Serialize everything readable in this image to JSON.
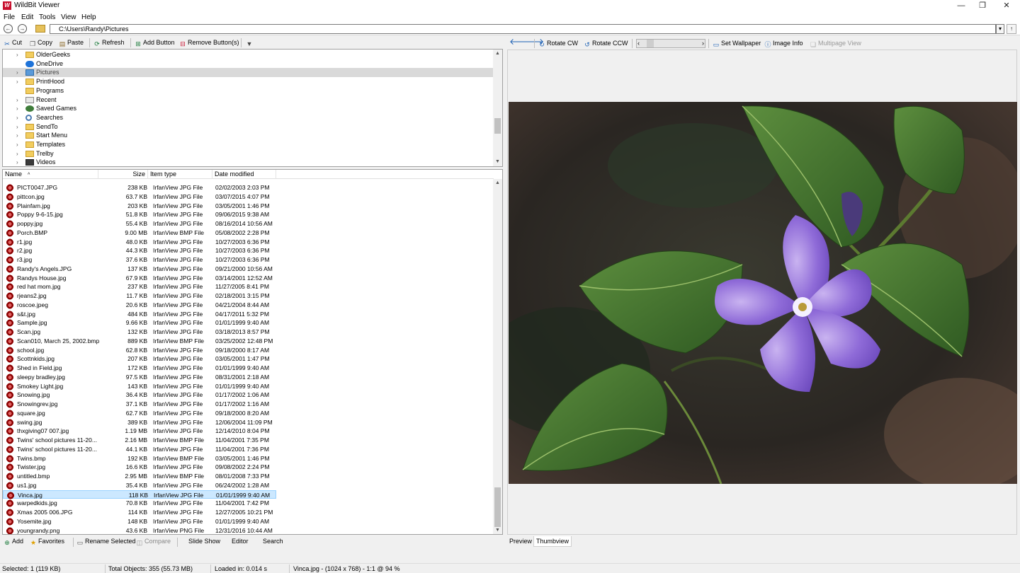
{
  "window": {
    "title": "WildBit Viewer",
    "icon_text": "W",
    "minimize": "—",
    "maximize": "❐",
    "close": "✕"
  },
  "menu": [
    "File",
    "Edit",
    "Tools",
    "View",
    "Help"
  ],
  "address": {
    "path": "C:\\Users\\Randy\\Pictures"
  },
  "left_toolbar": {
    "cut": "Cut",
    "copy": "Copy",
    "paste": "Paste",
    "refresh": "Refresh",
    "add_button": "Add Button",
    "remove_button": "Remove Button(s)"
  },
  "tree": [
    {
      "label": "OlderGeeks",
      "icon": "folder",
      "expand": "›"
    },
    {
      "label": "OneDrive",
      "icon": "cloud",
      "expand": ""
    },
    {
      "label": "Pictures",
      "icon": "pictures",
      "expand": "›",
      "selected": true
    },
    {
      "label": "PrintHood",
      "icon": "folder",
      "expand": "›"
    },
    {
      "label": "Programs",
      "icon": "folder",
      "expand": ""
    },
    {
      "label": "Recent",
      "icon": "recent",
      "expand": "›"
    },
    {
      "label": "Saved Games",
      "icon": "games",
      "expand": "›"
    },
    {
      "label": "Searches",
      "icon": "search",
      "expand": "›"
    },
    {
      "label": "SendTo",
      "icon": "folder",
      "expand": "›"
    },
    {
      "label": "Start Menu",
      "icon": "folder",
      "expand": "›"
    },
    {
      "label": "Templates",
      "icon": "folder",
      "expand": "›"
    },
    {
      "label": "Trelby",
      "icon": "folder",
      "expand": "›"
    },
    {
      "label": "Videos",
      "icon": "videos",
      "expand": "›"
    }
  ],
  "file_headers": {
    "name": "Name",
    "size": "Size",
    "type": "Item type",
    "date": "Date modified"
  },
  "files": [
    {
      "name": "PICT0047.JPG",
      "size": "238 KB",
      "type": "IrfanView JPG File",
      "date": "02/02/2003 2:03 PM"
    },
    {
      "name": "pittcon.jpg",
      "size": "63.7 KB",
      "type": "IrfanView JPG File",
      "date": "03/07/2015 4:07 PM"
    },
    {
      "name": "Plainfam.jpg",
      "size": "203 KB",
      "type": "IrfanView JPG File",
      "date": "03/05/2001 1:46 PM"
    },
    {
      "name": "Poppy 9-6-15.jpg",
      "size": "51.8 KB",
      "type": "IrfanView JPG File",
      "date": "09/06/2015 9:38 AM"
    },
    {
      "name": "poppy.jpg",
      "size": "55.4 KB",
      "type": "IrfanView JPG File",
      "date": "08/16/2014 10:56 AM"
    },
    {
      "name": "Porch.BMP",
      "size": "9.00 MB",
      "type": "IrfanView BMP File",
      "date": "05/08/2002 2:28 PM"
    },
    {
      "name": "r1.jpg",
      "size": "48.0 KB",
      "type": "IrfanView JPG File",
      "date": "10/27/2003 6:36 PM"
    },
    {
      "name": "r2.jpg",
      "size": "44.3 KB",
      "type": "IrfanView JPG File",
      "date": "10/27/2003 6:36 PM"
    },
    {
      "name": "r3.jpg",
      "size": "37.6 KB",
      "type": "IrfanView JPG File",
      "date": "10/27/2003 6:36 PM"
    },
    {
      "name": "Randy's Angels.JPG",
      "size": "137 KB",
      "type": "IrfanView JPG File",
      "date": "09/21/2000 10:56 AM"
    },
    {
      "name": "Randys House.jpg",
      "size": "67.9 KB",
      "type": "IrfanView JPG File",
      "date": "03/14/2001 12:52 AM"
    },
    {
      "name": "red hat mom.jpg",
      "size": "237 KB",
      "type": "IrfanView JPG File",
      "date": "11/27/2005 8:41 PM"
    },
    {
      "name": "rjeans2.jpg",
      "size": "11.7 KB",
      "type": "IrfanView JPG File",
      "date": "02/18/2001 3:15 PM"
    },
    {
      "name": "roscoe.jpeg",
      "size": "20.6 KB",
      "type": "IrfanView JPG File",
      "date": "04/21/2004 8:44 AM"
    },
    {
      "name": "s&t.jpg",
      "size": "484 KB",
      "type": "IrfanView JPG File",
      "date": "04/17/2011 5:32 PM"
    },
    {
      "name": "Sample.jpg",
      "size": "9.66 KB",
      "type": "IrfanView JPG File",
      "date": "01/01/1999 9:40 AM"
    },
    {
      "name": "Scan.jpg",
      "size": "132 KB",
      "type": "IrfanView JPG File",
      "date": "03/18/2013 8:57 PM"
    },
    {
      "name": "Scan010, March 25, 2002.bmp",
      "size": "889 KB",
      "type": "IrfanView BMP File",
      "date": "03/25/2002 12:48 PM"
    },
    {
      "name": "school.jpg",
      "size": "62.8 KB",
      "type": "IrfanView JPG File",
      "date": "09/18/2000 8:17 AM"
    },
    {
      "name": "Scottnkids.jpg",
      "size": "207 KB",
      "type": "IrfanView JPG File",
      "date": "03/05/2001 1:47 PM"
    },
    {
      "name": "Shed in Field.jpg",
      "size": "172 KB",
      "type": "IrfanView JPG File",
      "date": "01/01/1999 9:40 AM"
    },
    {
      "name": "sleepy bradley.jpg",
      "size": "97.5 KB",
      "type": "IrfanView JPG File",
      "date": "08/31/2001 2:18 AM"
    },
    {
      "name": "Smokey Light.jpg",
      "size": "143 KB",
      "type": "IrfanView JPG File",
      "date": "01/01/1999 9:40 AM"
    },
    {
      "name": "Snowing.jpg",
      "size": "36.4 KB",
      "type": "IrfanView JPG File",
      "date": "01/17/2002 1:06 AM"
    },
    {
      "name": "Snowingrev.jpg",
      "size": "37.1 KB",
      "type": "IrfanView JPG File",
      "date": "01/17/2002 1:16 AM"
    },
    {
      "name": "square.jpg",
      "size": "62.7 KB",
      "type": "IrfanView JPG File",
      "date": "09/18/2000 8:20 AM"
    },
    {
      "name": "swing.jpg",
      "size": "389 KB",
      "type": "IrfanView JPG File",
      "date": "12/06/2004 11:09 PM"
    },
    {
      "name": "thxgiving07 007.jpg",
      "size": "1.19 MB",
      "type": "IrfanView JPG File",
      "date": "12/14/2010 8:04 PM"
    },
    {
      "name": "Twins' school pictures 11-20...",
      "size": "2.16 MB",
      "type": "IrfanView BMP File",
      "date": "11/04/2001 7:35 PM"
    },
    {
      "name": "Twins' school pictures 11-20...",
      "size": "44.1 KB",
      "type": "IrfanView JPG File",
      "date": "11/04/2001 7:36 PM"
    },
    {
      "name": "Twins.bmp",
      "size": "192 KB",
      "type": "IrfanView BMP File",
      "date": "03/05/2001 1:46 PM"
    },
    {
      "name": "Twister.jpg",
      "size": "16.6 KB",
      "type": "IrfanView JPG File",
      "date": "09/08/2002 2:24 PM"
    },
    {
      "name": "untitled.bmp",
      "size": "2.95 MB",
      "type": "IrfanView BMP File",
      "date": "08/01/2008 7:33 PM"
    },
    {
      "name": "us1.jpg",
      "size": "35.4 KB",
      "type": "IrfanView JPG File",
      "date": "06/24/2002 1:28 AM"
    },
    {
      "name": "Vinca.jpg",
      "size": "118 KB",
      "type": "IrfanView JPG File",
      "date": "01/01/1999 9:40 AM",
      "selected": true
    },
    {
      "name": "warpedkids.jpg",
      "size": "70.8 KB",
      "type": "IrfanView JPG File",
      "date": "11/04/2001 7:42 PM"
    },
    {
      "name": "Xmas 2005 006.JPG",
      "size": "114 KB",
      "type": "IrfanView JPG File",
      "date": "12/27/2005 10:21 PM"
    },
    {
      "name": "Yosemite.jpg",
      "size": "148 KB",
      "type": "IrfanView JPG File",
      "date": "01/01/1999 9:40 AM"
    },
    {
      "name": "youngrandy.png",
      "size": "43.6 KB",
      "type": "IrfanView PNG File",
      "date": "12/31/2016 10:44 AM"
    }
  ],
  "left_bottom": {
    "add": "Add",
    "favorites": "Favorites",
    "rename": "Rename Selected",
    "compare": "Compare",
    "slideshow": "Slide Show",
    "editor": "Editor",
    "search": "Search"
  },
  "right_toolbar": {
    "rotate_cw": "Rotate CW",
    "rotate_ccw": "Rotate CCW",
    "set_wallpaper": "Set Wallpaper",
    "image_info": "Image Info",
    "multipage": "Multipage View"
  },
  "right_tabs": {
    "preview": "Preview",
    "thumbview": "Thumbview"
  },
  "status": {
    "selected": "Selected: 1 (119 KB)",
    "total": "Total Objects: 355 (55.73 MB)",
    "loaded": "Loaded in: 0.014 s",
    "image": "Vinca.jpg -  (1024 x 768) - 1:1 @ 94  %"
  },
  "colors": {
    "selection": "#cce8ff",
    "tree_selection": "#d9d9d9",
    "accent_icon": "#c8102e",
    "flower": "#8e6bd6",
    "leaf": "#3f6b2e"
  }
}
